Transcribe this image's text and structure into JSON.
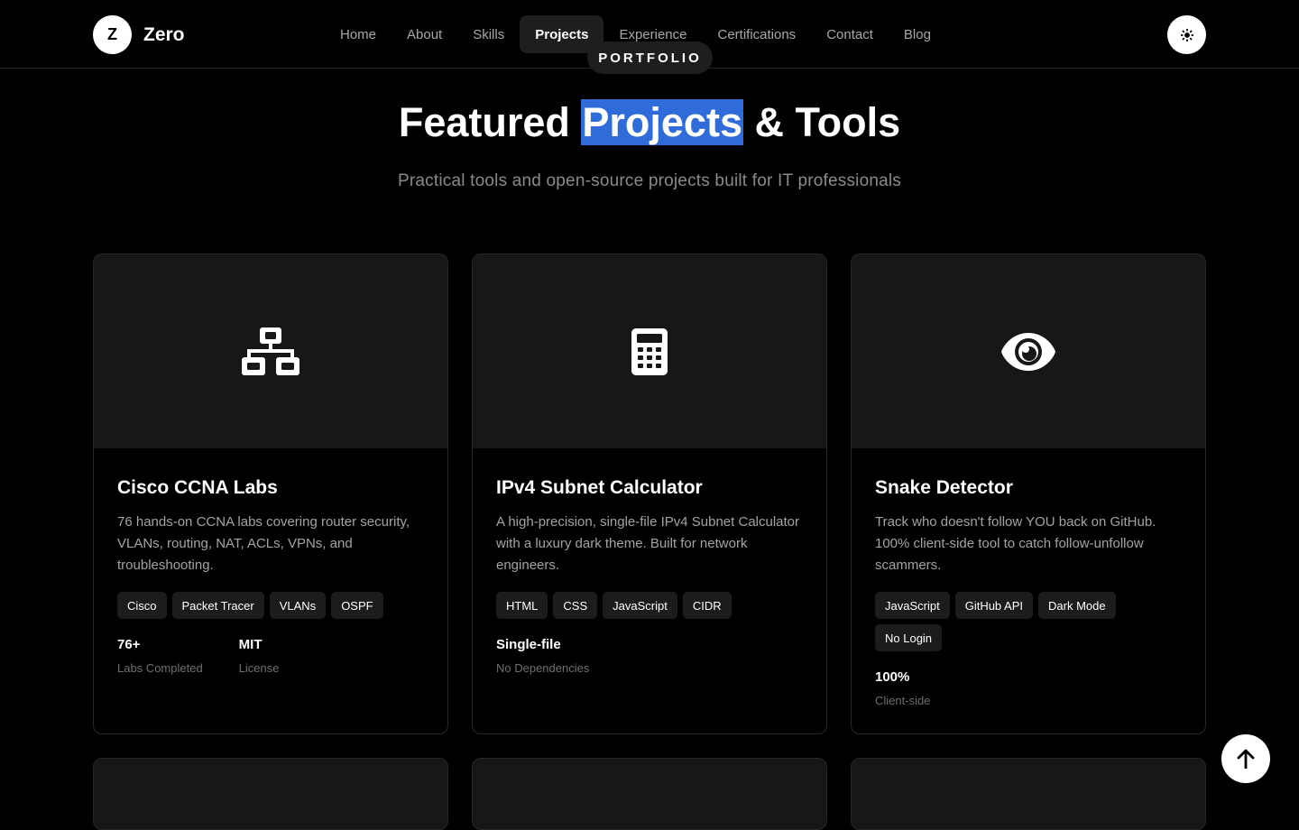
{
  "brand": {
    "initial": "Z",
    "name": "Zero"
  },
  "nav": {
    "items": [
      {
        "label": "Home",
        "active": false
      },
      {
        "label": "About",
        "active": false
      },
      {
        "label": "Skills",
        "active": false
      },
      {
        "label": "Projects",
        "active": true
      },
      {
        "label": "Experience",
        "active": false
      },
      {
        "label": "Certifications",
        "active": false
      },
      {
        "label": "Contact",
        "active": false
      },
      {
        "label": "Blog",
        "active": false
      }
    ],
    "theme_toggle_icon": "sun-icon"
  },
  "section": {
    "badge": "PORTFOLIO",
    "title_before": "Featured ",
    "title_highlight": "Projects",
    "title_after": " & Tools",
    "subtitle": "Practical tools and open-source projects built for IT professionals"
  },
  "projects": [
    {
      "icon": "network-icon",
      "title": "Cisco CCNA Labs",
      "description": "76 hands-on CCNA labs covering router security, VLANs, routing, NAT, ACLs, VPNs, and troubleshooting.",
      "tags": [
        "Cisco",
        "Packet Tracer",
        "VLANs",
        "OSPF"
      ],
      "stats": [
        {
          "value": "76+",
          "label": "Labs Completed"
        },
        {
          "value": "MIT",
          "label": "License"
        }
      ]
    },
    {
      "icon": "calculator-icon",
      "title": "IPv4 Subnet Calculator",
      "description": "A high-precision, single-file IPv4 Subnet Calculator with a luxury dark theme. Built for network engineers.",
      "tags": [
        "HTML",
        "CSS",
        "JavaScript",
        "CIDR"
      ],
      "stats": [
        {
          "value": "Single-file",
          "label": "No Dependencies"
        }
      ]
    },
    {
      "icon": "eye-icon",
      "title": "Snake Detector",
      "description": "Track who doesn't follow YOU back on GitHub. 100% client-side tool to catch follow-unfollow scammers.",
      "tags": [
        "JavaScript",
        "GitHub API",
        "Dark Mode",
        "No Login"
      ],
      "stats": [
        {
          "value": "100%",
          "label": "Client-side"
        }
      ]
    }
  ],
  "scroll_top_icon": "arrow-up-icon",
  "colors": {
    "background": "#000000",
    "card_media": "#171717",
    "highlight": "#2f6bd9",
    "muted_text": "#a3a3a3"
  }
}
